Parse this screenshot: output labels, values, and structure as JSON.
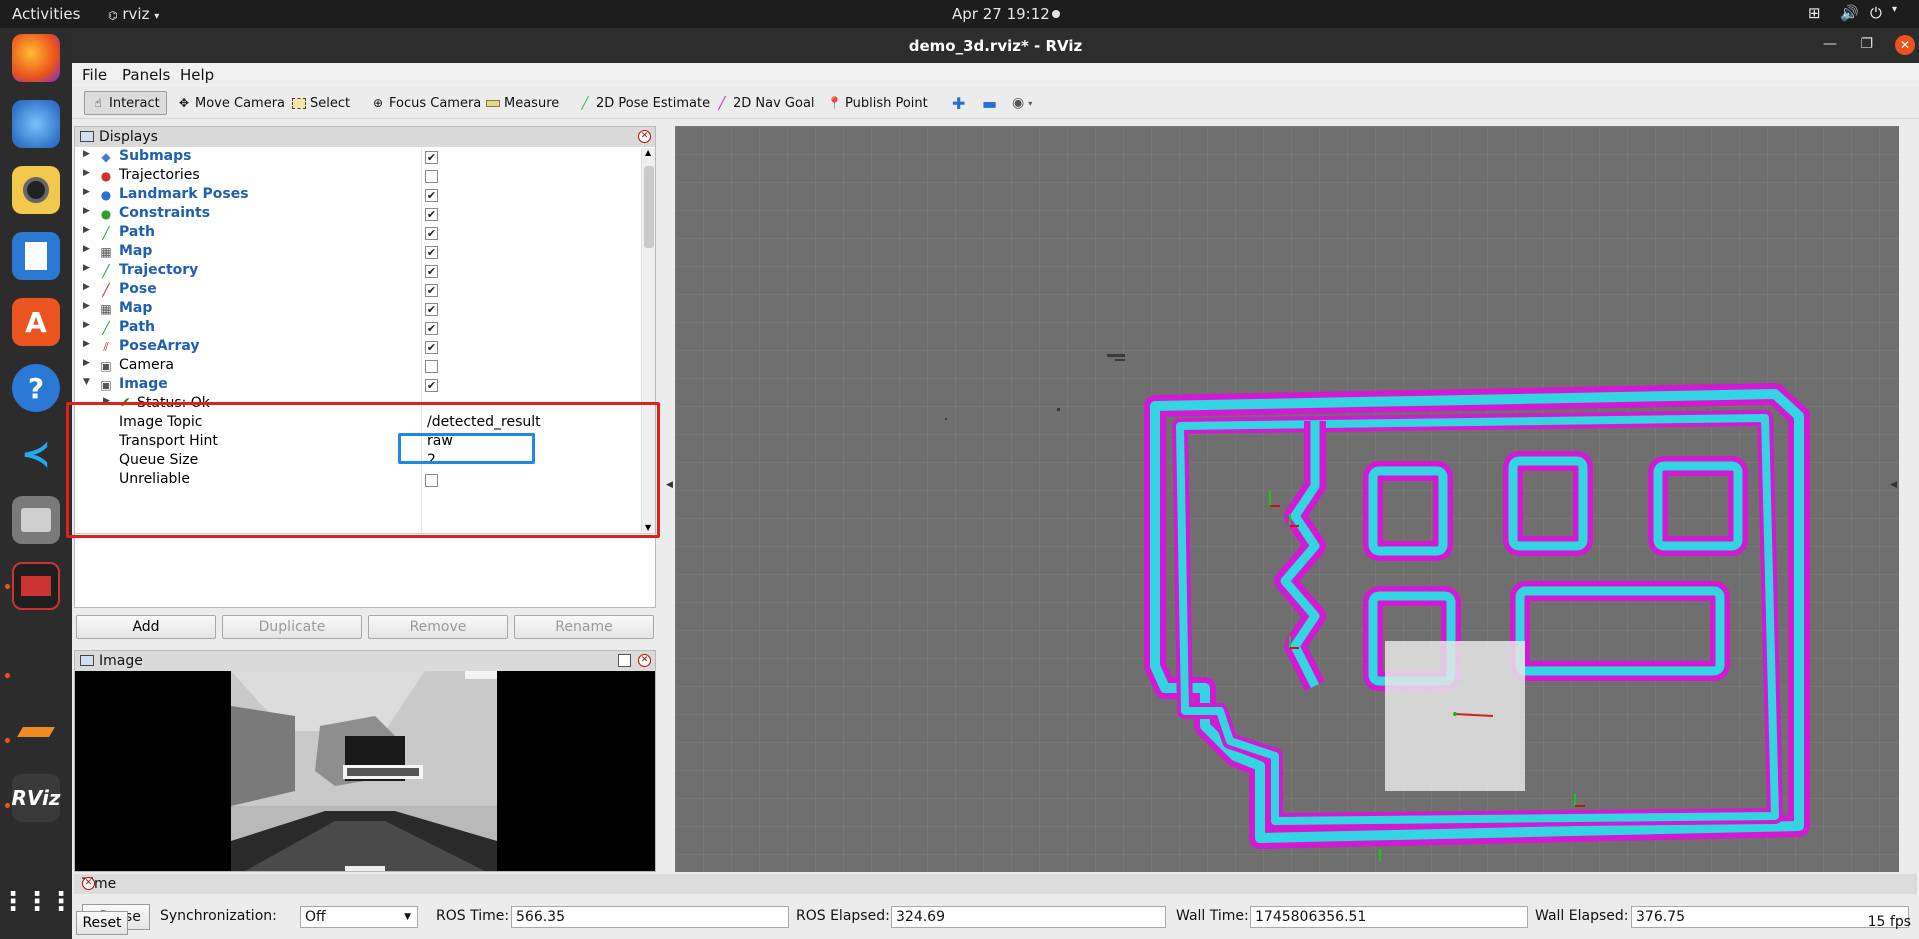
{
  "topbar": {
    "activities": "Activities",
    "app_name": "rviz",
    "clock": "Apr 27  19:12"
  },
  "window": {
    "title": "demo_3d.rviz* - RViz"
  },
  "menu": {
    "file": "File",
    "panels": "Panels",
    "help": "Help"
  },
  "toolbar": {
    "interact": "Interact",
    "move_camera": "Move Camera",
    "select": "Select",
    "focus_camera": "Focus Camera",
    "measure": "Measure",
    "pose_estimate": "2D Pose Estimate",
    "nav_goal": "2D Nav Goal",
    "publish_point": "Publish Point"
  },
  "displays": {
    "title": "Displays",
    "items": [
      {
        "label": "Submaps",
        "checked": true,
        "blue": true
      },
      {
        "label": "Trajectories",
        "checked": false,
        "blue": false
      },
      {
        "label": "Landmark Poses",
        "checked": true,
        "blue": true
      },
      {
        "label": "Constraints",
        "checked": true,
        "blue": true
      },
      {
        "label": "Path",
        "checked": true,
        "blue": true
      },
      {
        "label": "Map",
        "checked": true,
        "blue": true
      },
      {
        "label": "Trajectory",
        "checked": true,
        "blue": true
      },
      {
        "label": "Pose",
        "checked": true,
        "blue": true
      },
      {
        "label": "Map",
        "checked": true,
        "blue": true
      },
      {
        "label": "Path",
        "checked": true,
        "blue": true
      },
      {
        "label": "PoseArray",
        "checked": true,
        "blue": true
      },
      {
        "label": "Camera",
        "checked": false,
        "blue": false
      },
      {
        "label": "Image",
        "checked": true,
        "blue": true
      }
    ],
    "image_props": {
      "status": "Status: Ok",
      "image_topic_label": "Image Topic",
      "image_topic_value": "/detected_result",
      "transport_hint_label": "Transport Hint",
      "transport_hint_value": "raw",
      "queue_size_label": "Queue Size",
      "queue_size_value": "2",
      "unreliable_label": "Unreliable"
    },
    "buttons": {
      "add": "Add",
      "duplicate": "Duplicate",
      "remove": "Remove",
      "rename": "Rename"
    }
  },
  "image_panel": {
    "title": "Image"
  },
  "time_panel": {
    "title": "Time",
    "pause": "Pause",
    "sync_label": "Synchronization:",
    "sync_value": "Off",
    "ros_time_label": "ROS Time:",
    "ros_time": "566.35",
    "ros_elapsed_label": "ROS Elapsed:",
    "ros_elapsed": "324.69",
    "wall_time_label": "Wall Time:",
    "wall_time": "1745806356.51",
    "wall_elapsed_label": "Wall Elapsed:",
    "wall_elapsed": "376.75",
    "reset": "Reset",
    "fps": "15 fps"
  },
  "colors": {
    "highlight_red": "#e0201c",
    "highlight_blue": "#1e88e5",
    "costmap_cyan": "#33d6e0",
    "costmap_magenta": "#d21ad2",
    "accent_orange": "#e95420"
  }
}
